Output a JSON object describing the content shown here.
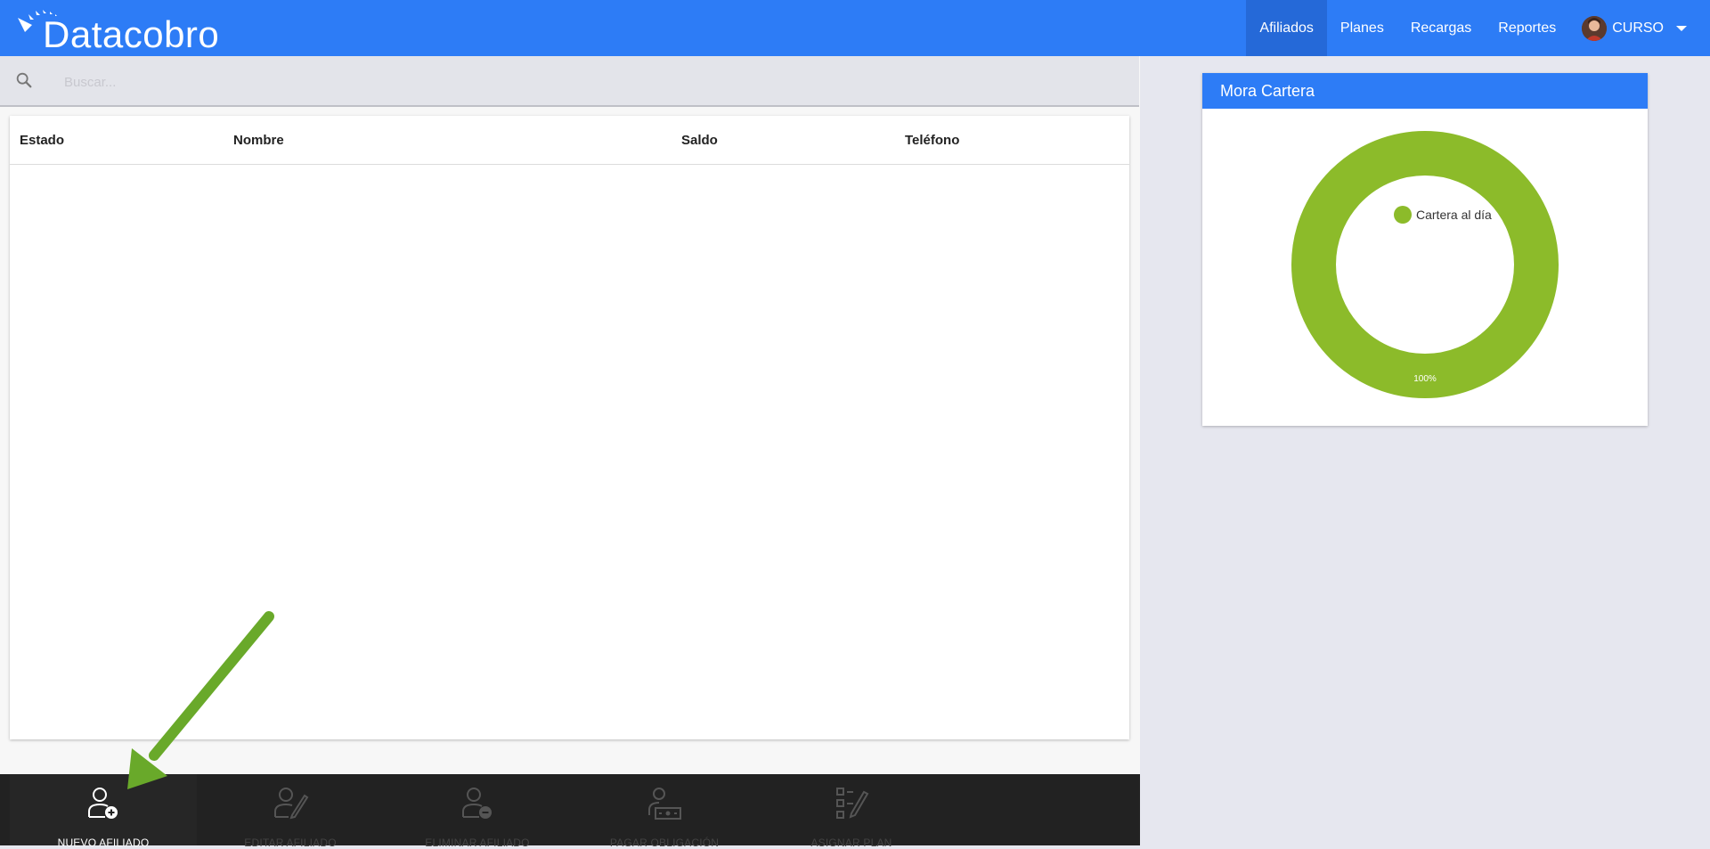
{
  "header": {
    "logo_text": "Datacobro",
    "nav": [
      {
        "label": "Afiliados",
        "active": true
      },
      {
        "label": "Planes",
        "active": false
      },
      {
        "label": "Recargas",
        "active": false
      },
      {
        "label": "Reportes",
        "active": false
      }
    ],
    "user_name": "CURSO"
  },
  "search": {
    "placeholder": "Buscar..."
  },
  "table": {
    "columns": [
      "Estado",
      "Nombre",
      "Saldo",
      "Teléfono"
    ],
    "rows": []
  },
  "actions": [
    {
      "label": "NUEVO AFILIADO",
      "icon": "user-plus-icon",
      "enabled": true
    },
    {
      "label": "EDITAR AFILIADO",
      "icon": "user-edit-icon",
      "enabled": false
    },
    {
      "label": "ELIMINAR AFILIADO",
      "icon": "user-minus-icon",
      "enabled": false
    },
    {
      "label": "PAGAR OBLIGACIÓN",
      "icon": "user-pay-icon",
      "enabled": false
    },
    {
      "label": "ASIGNAR PLAN",
      "icon": "checklist-edit-icon",
      "enabled": false
    }
  ],
  "chart_card": {
    "title": "Mora Cartera"
  },
  "chart_data": {
    "type": "pie",
    "categories": [
      "Cartera al día"
    ],
    "values": [
      100
    ],
    "data_labels": [
      "100%"
    ],
    "colors": [
      "#8cbb2a"
    ],
    "legend": "inside-top"
  },
  "colors": {
    "primary": "#2d7cf6",
    "primary_active": "#2569d8",
    "action_bar": "#222222",
    "donut_green": "#8cbb2a",
    "annotation_arrow": "#69a92a"
  }
}
